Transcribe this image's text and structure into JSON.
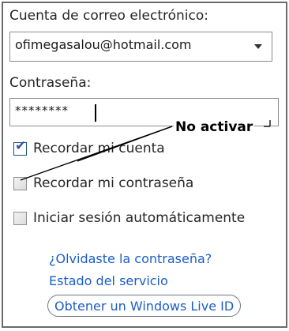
{
  "login": {
    "email_label": "Cuenta de correo electrónico:",
    "email_value": "ofimegasalou@hotmail.com",
    "password_label": "Contraseña:",
    "password_value": "********",
    "remember_account_label": "Recordar mi cuenta",
    "remember_account_checked": true,
    "remember_password_label": "Recordar mi contraseña",
    "remember_password_checked": false,
    "auto_signin_label": "Iniciar sesión automáticamente",
    "auto_signin_checked": false,
    "forgot_password_link": "¿Olvidaste la contraseña?",
    "service_status_link": "Estado del servicio",
    "get_live_id_button": "Obtener un Windows Live ID"
  },
  "annotation": {
    "text": "No activar"
  },
  "colors": {
    "link": "#1c5ec8",
    "checkmark": "#2d56a8",
    "panel_border": "#6b6b6b"
  }
}
